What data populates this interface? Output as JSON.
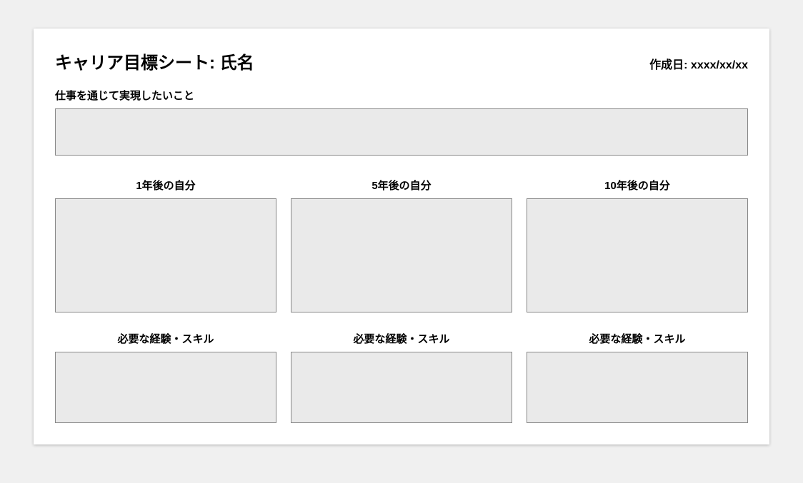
{
  "header": {
    "title": "キャリア目標シート: 氏名",
    "date_label": "作成日: xxxx/xx/xx"
  },
  "goal_section": {
    "label": "仕事を通じて実現したいこと",
    "value": ""
  },
  "future_row": [
    {
      "label": "1年後の自分",
      "value": ""
    },
    {
      "label": "5年後の自分",
      "value": ""
    },
    {
      "label": "10年後の自分",
      "value": ""
    }
  ],
  "skills_row": [
    {
      "label": "必要な経験・スキル",
      "value": ""
    },
    {
      "label": "必要な経験・スキル",
      "value": ""
    },
    {
      "label": "必要な経験・スキル",
      "value": ""
    }
  ]
}
